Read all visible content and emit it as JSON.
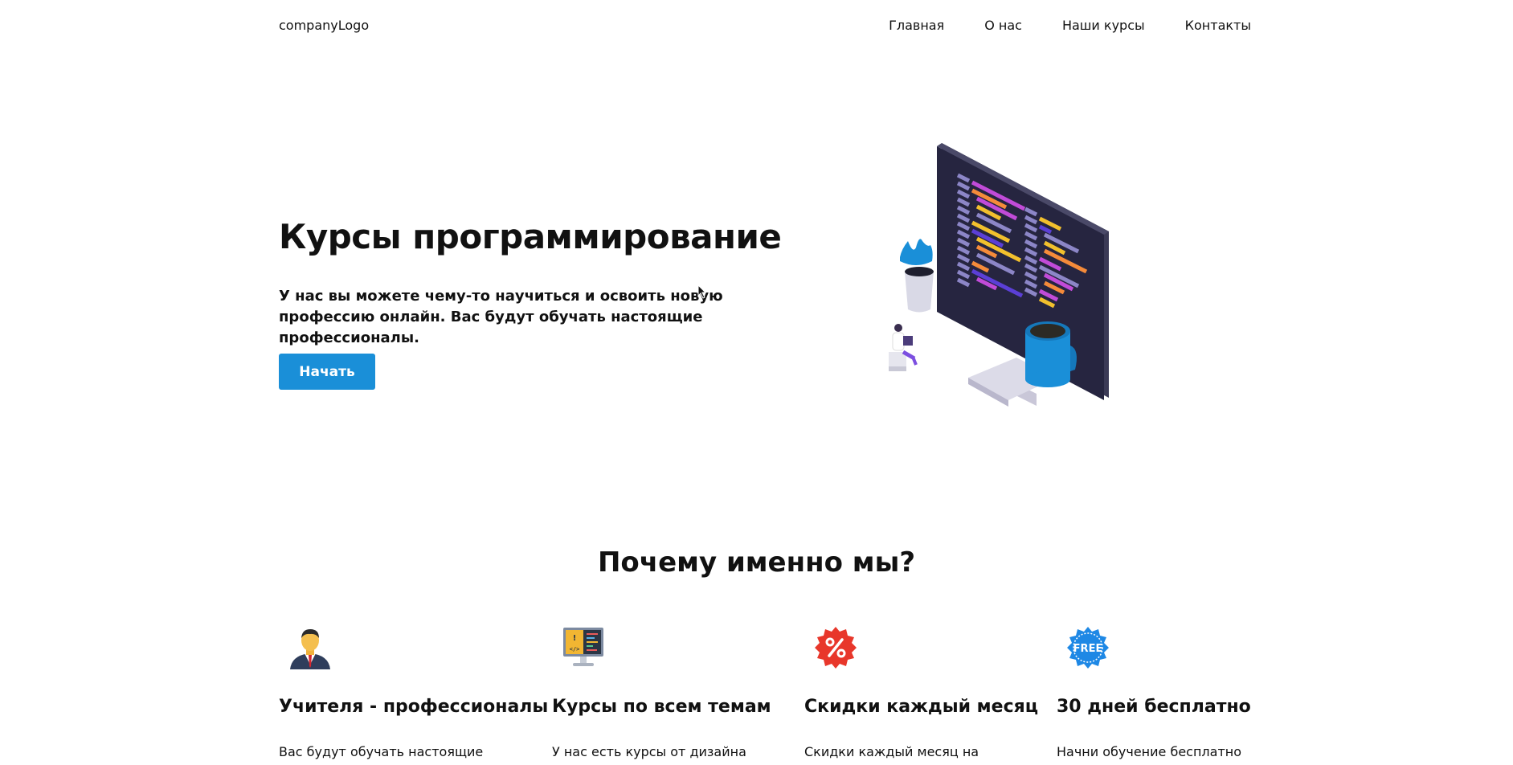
{
  "header": {
    "logo": "companyLogo",
    "nav": [
      "Главная",
      "О нас",
      "Наши курсы",
      "Контакты"
    ]
  },
  "hero": {
    "title": "Курсы программирование",
    "text": "У нас вы можете чему-то научиться и освоить новую профессию онлайн. Вас будут обучать настоящие профессионалы.",
    "button": "Начать"
  },
  "why": {
    "title": "Почему именно мы?",
    "features": [
      {
        "title": "Учителя - профессионалы",
        "text": "Вас будут обучать настоящие",
        "icon": "teacher-icon"
      },
      {
        "title": "Курсы по всем темам",
        "text": "У нас есть курсы от дизайна до",
        "icon": "code-monitor-icon"
      },
      {
        "title": "Скидки каждый месяц",
        "text": "Скидки каждый месяц на разные",
        "icon": "discount-badge-icon"
      },
      {
        "title": "30 дней бесплатно",
        "text": "Начни обучение бесплатно",
        "icon": "free-badge-icon"
      }
    ]
  },
  "colors": {
    "accent": "#1a8fd8",
    "text": "#111111",
    "discount": "#e8372b",
    "free": "#1e88e5"
  }
}
